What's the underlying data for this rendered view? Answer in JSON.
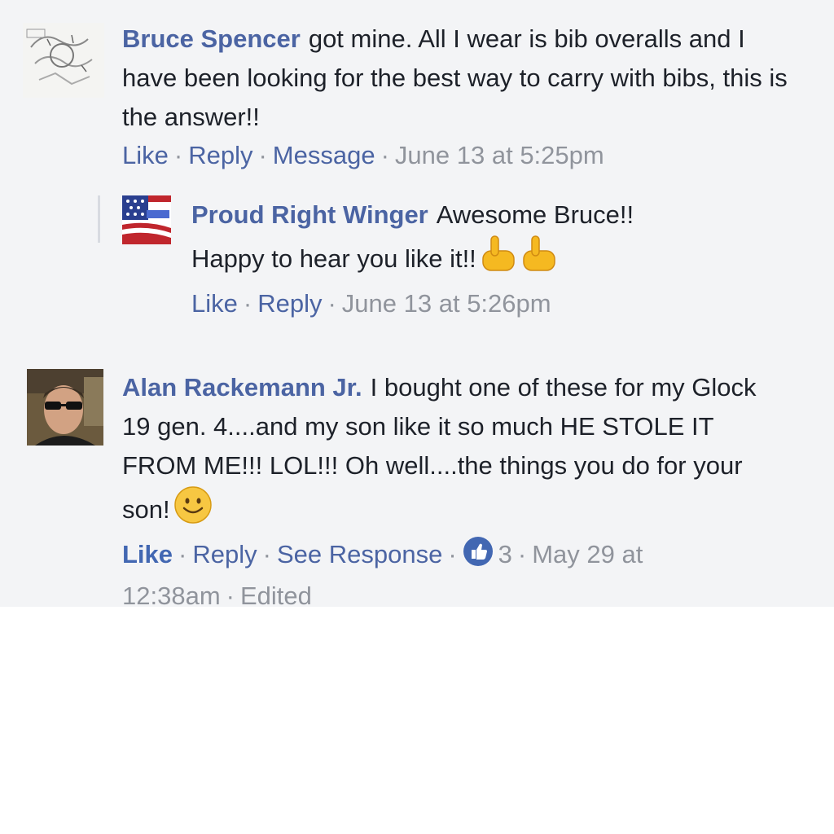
{
  "comments": [
    {
      "author": "Bruce Spencer",
      "text": "got mine. All I wear is bib overalls and I have been looking for the best way to carry with bibs, this is the answer!!",
      "actions": {
        "like": "Like",
        "reply": "Reply",
        "message": "Message"
      },
      "timestamp": "June 13 at 5:25pm",
      "avatar_icon": "sketch-drawing-avatar",
      "reply": {
        "author": "Proud Right Winger",
        "text": "Awesome Bruce!! Happy to hear you like it!!",
        "emoji": "pointing-hand-emoji",
        "actions": {
          "like": "Like",
          "reply": "Reply"
        },
        "timestamp": "June 13 at 5:26pm",
        "avatar_icon": "american-flag-avatar"
      }
    },
    {
      "author": "Alan Rackemann Jr.",
      "text": "I bought one of these for my Glock 19 gen. 4....and my son like it so much HE STOLE IT FROM ME!!! LOL!!! Oh well....the things you do for your son!",
      "emoji": "smiley-emoji",
      "actions": {
        "like": "Like",
        "reply": "Reply",
        "see_response": "See Response"
      },
      "like_count": "3",
      "timestamp": "May 29 at 12:38am",
      "edited": "Edited",
      "avatar_icon": "man-sunglasses-avatar"
    }
  ],
  "colors": {
    "author": "#4b64a3",
    "meta": "#90949c",
    "background": "#f3f4f6",
    "like_badge": "#4267b2"
  }
}
